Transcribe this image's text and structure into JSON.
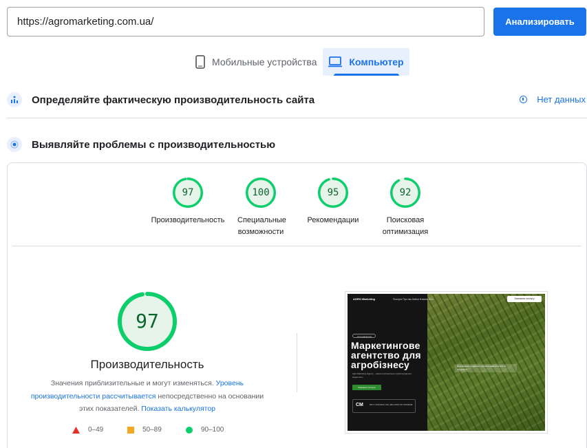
{
  "search": {
    "url_value": "https://agromarketing.com.ua/",
    "analyze_label": "Анализировать"
  },
  "tabs": [
    {
      "label": "Мобильные устройства",
      "icon": "smartphone-icon",
      "selected": false
    },
    {
      "label": "Компьютер",
      "icon": "laptop-icon",
      "selected": true
    }
  ],
  "field_data": {
    "title": "Определяйте фактическую производительность сайта",
    "no_data_label": "Нет данных",
    "icon": "field-data-icon"
  },
  "lab_data": {
    "title": "Выявляйте проблемы с производительностью",
    "icon": "lab-data-icon"
  },
  "scores": [
    {
      "value": 97,
      "label": "Производительность"
    },
    {
      "value": 100,
      "label": "Специальные возможности"
    },
    {
      "value": 95,
      "label": "Рекомендации"
    },
    {
      "value": 92,
      "label": "Поисковая оптимизация"
    }
  ],
  "performance": {
    "score": 97,
    "title": "Производительность",
    "desc_part1": "Значения приблизительные и могут изменяться. ",
    "desc_link1": "Уровень производительности рассчитывается",
    "desc_part2": " непосредственно на основании этих показателей. ",
    "desc_link2": "Показать калькулятор"
  },
  "legend": [
    {
      "range": "0–49",
      "symbol": "triangle",
      "color": "#e8302a"
    },
    {
      "range": "50–89",
      "symbol": "square",
      "color": "#f5a623"
    },
    {
      "range": "90–100",
      "symbol": "circle",
      "color": "#0cce6b"
    }
  ],
  "screenshot": {
    "logo_text": "AGRO Marketing",
    "nav_text": "Послуги   Про нас   Кейси   Новини   Блог",
    "nav_button": "Замовити послугу",
    "pill_text": "Агро-маркетинг",
    "headline": "Маркетингове агентство для агробізнесу",
    "sub_text": "Agro Marketing Agency – ваша персональна служба аграрного маркетингу",
    "green_button": "Замовити послуги",
    "badge_logo": "CM",
    "badge_text": "MH 3 VISCHIKU CM, MILLIONS OF UKRAINE",
    "overlay_text": "Допомагаємо аграрним підприємствам зростати та продавати"
  },
  "colors": {
    "accent": "#1a73e8",
    "pass_green": "#0cce6b",
    "pass_text": "#0d652d"
  }
}
